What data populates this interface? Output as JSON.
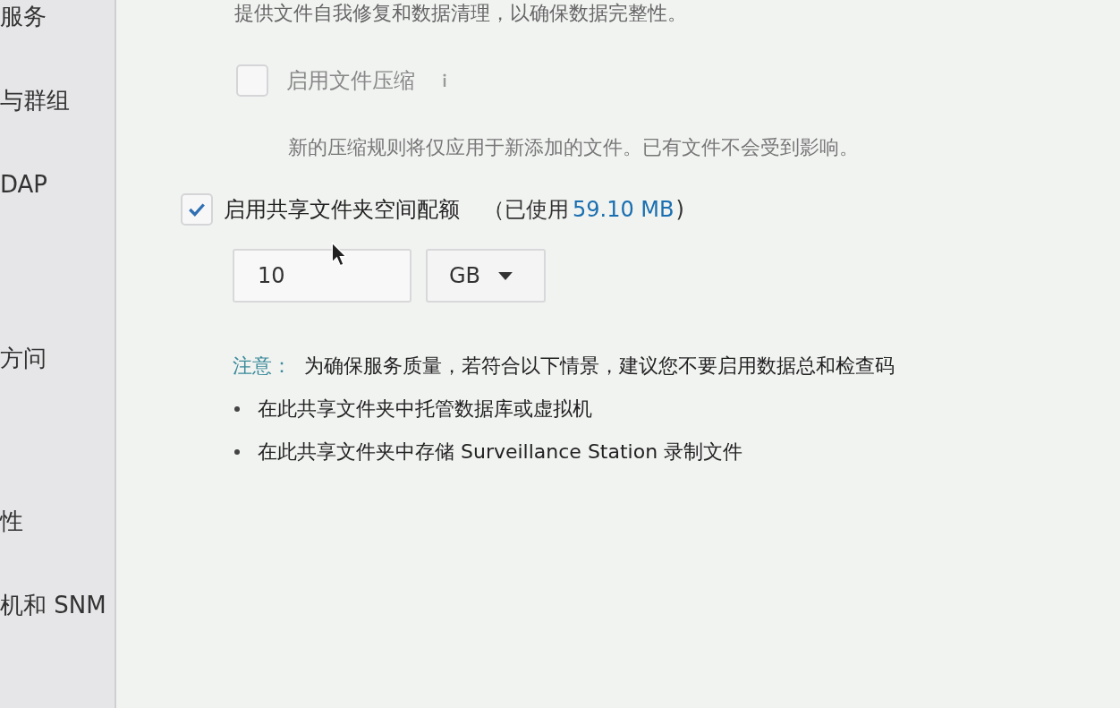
{
  "sidebar": {
    "items": [
      {
        "label": "服务",
        "selected": false
      },
      {
        "label": "与群组",
        "selected": false
      },
      {
        "label": "DAP",
        "selected": false
      },
      {
        "label": "方问",
        "selected": false
      },
      {
        "label": "性",
        "selected": false
      },
      {
        "label": "机和 SNM",
        "selected": false
      }
    ]
  },
  "content": {
    "intro": "提供文件自我修复和数据清理，以确保数据完整性。",
    "options": [
      {
        "label": "启用文件压缩",
        "checked": false,
        "info": true,
        "description": "新的压缩规则将仅应用于新添加的文件。已有文件不会受到影响。"
      },
      {
        "label": "启用共享文件夹空间配额",
        "checked": true,
        "info": false,
        "usage_label": "（已使用",
        "usage_value": "59.10 MB",
        "usage_close": ")"
      }
    ],
    "quota": {
      "value": "10",
      "unit": "GB"
    },
    "note": {
      "label": "注意：",
      "text": "为确保服务质量，若符合以下情景，建议您不要启用数据总和检查码",
      "bullets": [
        "在此共享文件夹中托管数据库或虚拟机",
        "在此共享文件夹中存储 Surveillance Station 录制文件"
      ]
    }
  }
}
